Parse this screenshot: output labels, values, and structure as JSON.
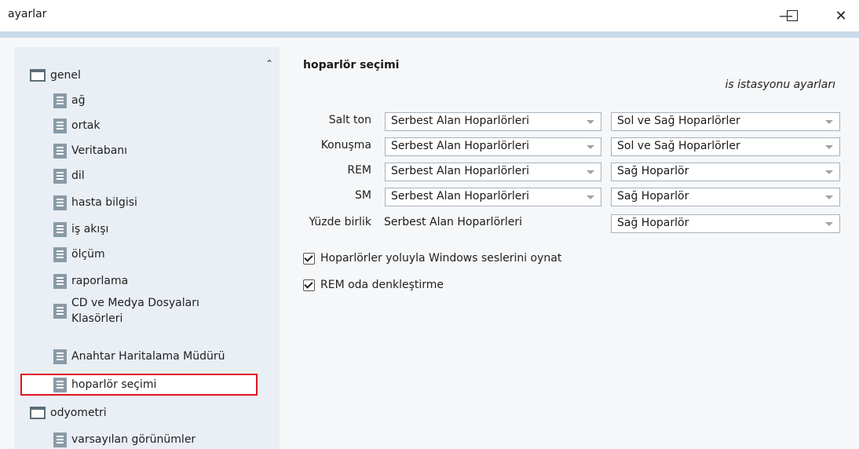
{
  "window": {
    "title": "ayarlar",
    "minimize_icon": "minimize-icon",
    "maximize_icon": "maximize-icon",
    "close_icon": "close-icon"
  },
  "sidebar": {
    "items": [
      {
        "label": "genel",
        "icon": "folder-icon",
        "level": 0
      },
      {
        "label": "ağ",
        "icon": "document-icon",
        "level": 1
      },
      {
        "label": "ortak",
        "icon": "document-icon",
        "level": 1
      },
      {
        "label": "Veritabanı",
        "icon": "document-icon",
        "level": 1
      },
      {
        "label": "dil",
        "icon": "document-icon",
        "level": 1
      },
      {
        "label": "hasta bilgisi",
        "icon": "document-icon",
        "level": 1
      },
      {
        "label": "iş akışı",
        "icon": "document-icon",
        "level": 1
      },
      {
        "label": "ölçüm",
        "icon": "document-icon",
        "level": 1
      },
      {
        "label": "raporlama",
        "icon": "document-icon",
        "level": 1
      },
      {
        "label": "CD ve Medya Dosyaları",
        "label2": "Klasörleri",
        "icon": "document-icon",
        "level": 1
      },
      {
        "label": "Anahtar Haritalama Müdürü",
        "icon": "document-icon",
        "level": 1
      },
      {
        "label": "hoparlör seçimi",
        "icon": "document-icon",
        "level": 1,
        "selected": true
      },
      {
        "label": "odyometri",
        "icon": "folder-icon",
        "level": 0
      },
      {
        "label": "varsayılan görünümler",
        "icon": "document-icon",
        "level": 1
      }
    ],
    "scroll_up_icon": "chevron-up-icon"
  },
  "panel": {
    "title": "hoparlör seçimi",
    "subtitle": "is istasyonu ayarları",
    "rows": [
      {
        "label": "Salt ton",
        "source": "Serbest Alan Hoparlörleri",
        "output": "Sol ve Sağ Hoparlörler",
        "source_is_combo": true
      },
      {
        "label": "Konuşma",
        "source": "Serbest Alan Hoparlörleri",
        "output": "Sol ve Sağ Hoparlörler",
        "source_is_combo": true
      },
      {
        "label": "REM",
        "source": "Serbest Alan Hoparlörleri",
        "output": "Sağ Hoparlör",
        "source_is_combo": true
      },
      {
        "label": "SM",
        "source": "Serbest Alan Hoparlörleri",
        "output": "Sağ Hoparlör",
        "source_is_combo": true
      },
      {
        "label": "Yüzde birlik",
        "source": "Serbest Alan Hoparlörleri",
        "output": "Sağ Hoparlör",
        "source_is_combo": false
      }
    ],
    "checkboxes": [
      {
        "label": "Hoparlörler yoluyla Windows seslerini oynat",
        "checked": true
      },
      {
        "label": "REM oda denkleştirme",
        "checked": true
      }
    ]
  },
  "colors": {
    "selection_border": "#e0141b",
    "sidebar_bg": "#e9eff5",
    "title_border": "#c7dbea"
  }
}
